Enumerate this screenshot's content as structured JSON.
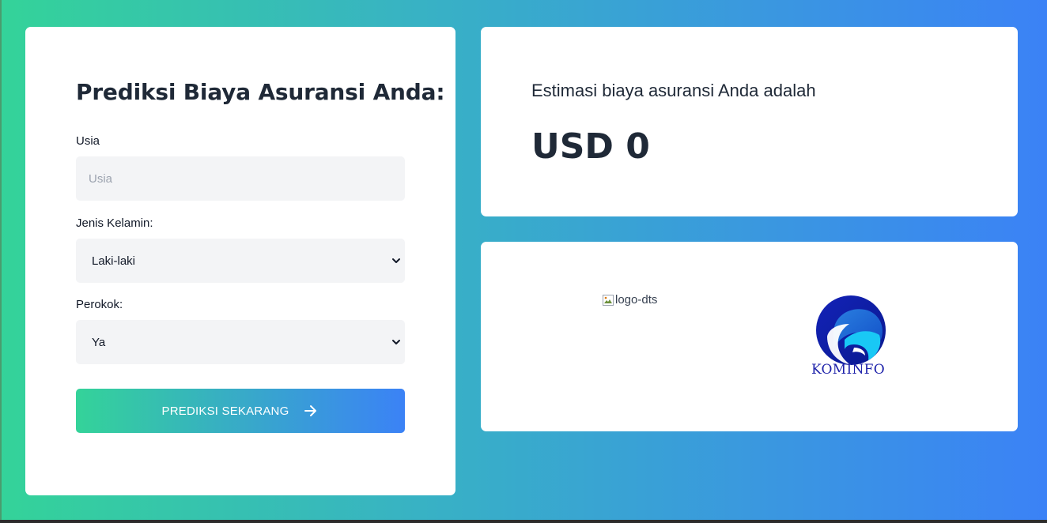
{
  "form": {
    "title": "Prediksi Biaya Asuransi Anda:",
    "age_label": "Usia",
    "age_placeholder": "Usia",
    "gender_label": "Jenis Kelamin:",
    "gender_value": "Laki-laki",
    "smoker_label": "Perokok:",
    "smoker_value": "Ya",
    "submit_label": "PREDIKSI SEKARANG"
  },
  "result": {
    "text": "Estimasi biaya asuransi Anda adalah",
    "value": "USD 0"
  },
  "logos": {
    "dts_alt": "logo-dts",
    "kominfo_text": "KOMINFO"
  },
  "icons": {
    "submit": "arrow-right-icon",
    "select": "chevron-down-icon",
    "broken_image": "broken-image-icon"
  },
  "colors": {
    "gradient_start": "#34d399",
    "gradient_end": "#3b82f6",
    "kominfo_blue": "#1e22aa"
  }
}
